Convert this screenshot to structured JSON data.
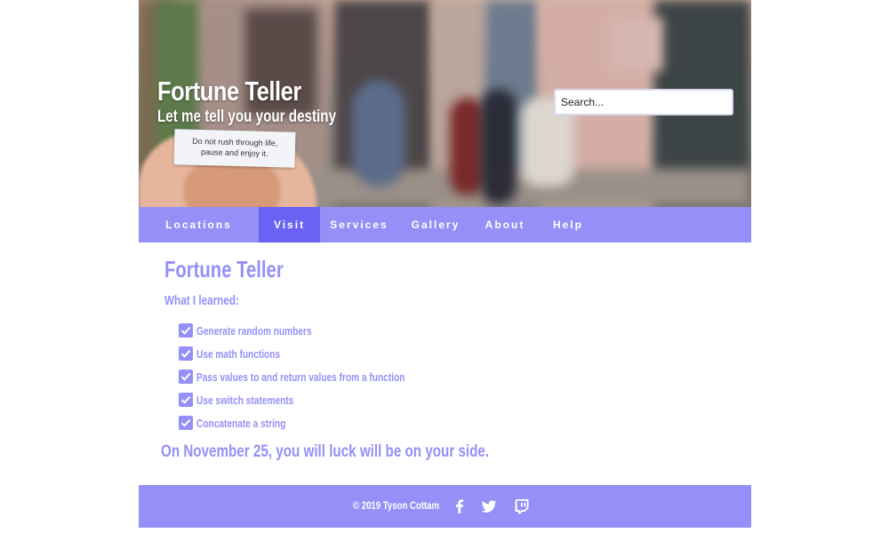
{
  "colors": {
    "accent": "#9590f8",
    "accent_active": "#6a62f2",
    "text_on_accent": "#ffffff"
  },
  "header": {
    "title": "Fortune Teller",
    "tagline": "Let me tell you your destiny",
    "fortune_slip_line1": "Do not rush through life,",
    "fortune_slip_line2": "pause and enjoy it.",
    "search_placeholder": "Search..."
  },
  "nav": {
    "items": [
      {
        "label": "Locations",
        "active": false
      },
      {
        "label": "Visit",
        "active": true
      },
      {
        "label": "Services",
        "active": false
      },
      {
        "label": "Gallery",
        "active": false
      },
      {
        "label": "About",
        "active": false
      },
      {
        "label": "Help",
        "active": false
      }
    ]
  },
  "main": {
    "title": "Fortune Teller",
    "learned_heading": "What I learned:",
    "learned_items": [
      {
        "label": "Generate random numbers",
        "checked": true
      },
      {
        "label": "Use math functions",
        "checked": true
      },
      {
        "label": "Pass values to and return values from a function",
        "checked": true
      },
      {
        "label": "Use switch statements",
        "checked": true
      },
      {
        "label": "Concatenate a string",
        "checked": true
      }
    ],
    "fortune": "On November 25, you will luck will be on your side."
  },
  "footer": {
    "copyright": "© 2019 Tyson Cottam",
    "social": [
      {
        "icon": "facebook-icon"
      },
      {
        "icon": "twitter-icon"
      },
      {
        "icon": "twitch-icon"
      }
    ]
  }
}
